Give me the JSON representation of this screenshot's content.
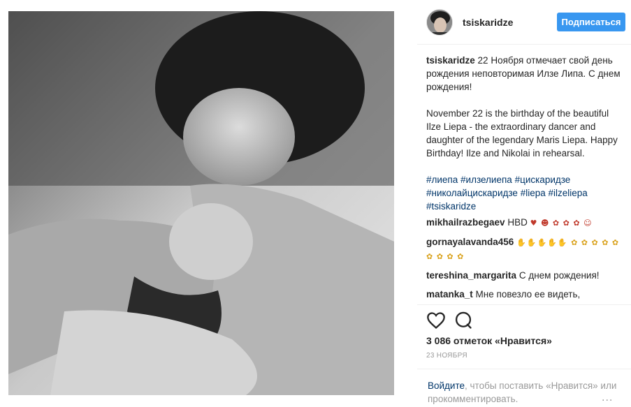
{
  "post": {
    "username": "tsiskaridze",
    "follow_label": "Подписаться",
    "caption": {
      "username": "tsiskaridze",
      "ru_text": " 22 Ноября отмечает свой день рождения неповторимая Илзе Липа. С днем рождения!",
      "en_text": "November 22 is the birthday of the beautiful Ilze Liepa - the extraordinary dancer and daughter of the legendary Maris Liepa. Happy Birthday! Ilze and Nikolai in rehearsal.",
      "hashtags": [
        "#лиепа",
        "#илзелиепа",
        "#цискаридзе",
        "#николайцискаридзе",
        "#liepa",
        "#ilzeliepa",
        "#tsiskaridze"
      ]
    },
    "comments": [
      {
        "user": "mikhailrazbegaev",
        "text": "HBD",
        "emoji": "♥ ☻ ✿ ✿ ✿ ☺"
      },
      {
        "user": "gornayalavanda456",
        "text": "",
        "emoji": "✋✋✋✋✋ ✿ ✿ ✿ ✿ ✿ ✿ ✿ ✿ ✿"
      },
      {
        "user": "tereshina_margarita",
        "text": " С днем рождения!",
        "emoji": ""
      },
      {
        "user": "matanka_t",
        "text": " Мне повезло ее видеть,",
        "emoji": ""
      }
    ],
    "icons": {
      "like": "heart-icon",
      "comment": "comment-bubble-icon"
    },
    "likes_text": "3 086 отметок «Нравится»",
    "date": "23 НОЯБРЯ",
    "login": {
      "link": "Войдите",
      "text": ", чтобы поставить «Нравится» или прокомментировать.",
      "more": "..."
    },
    "colors": {
      "accent": "#3897f0",
      "link": "#003569",
      "muted": "#999999"
    }
  }
}
